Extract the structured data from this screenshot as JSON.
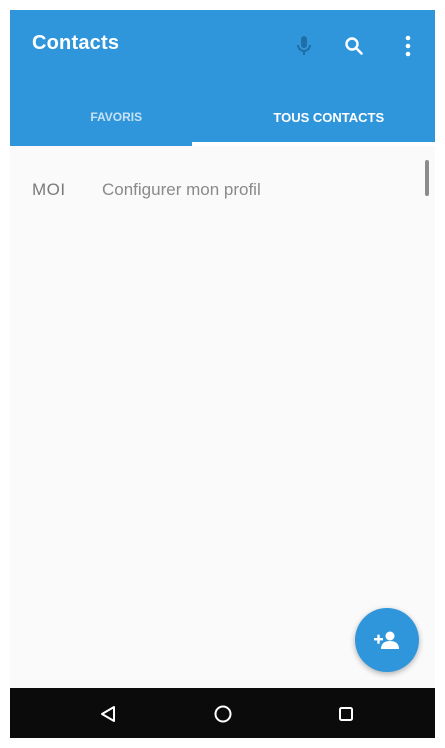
{
  "app": {
    "title": "Contacts"
  },
  "toolbar": {
    "icons": [
      "microphone-icon",
      "search-icon",
      "more-vert-icon"
    ]
  },
  "tabs": [
    {
      "label": "FAVORIS",
      "active": false
    },
    {
      "label": "TOUS CONTACTS",
      "active": true
    }
  ],
  "profile": {
    "me_label": "MOI",
    "setup_text": "Configurer mon profil"
  },
  "fab": {
    "icon": "add-person-icon"
  },
  "navbar": {
    "icons": [
      "back-icon",
      "home-icon",
      "recents-icon"
    ]
  },
  "colors": {
    "primary": "#2f96dc",
    "surface": "#fafafa",
    "navbar": "#0b0b0b"
  }
}
